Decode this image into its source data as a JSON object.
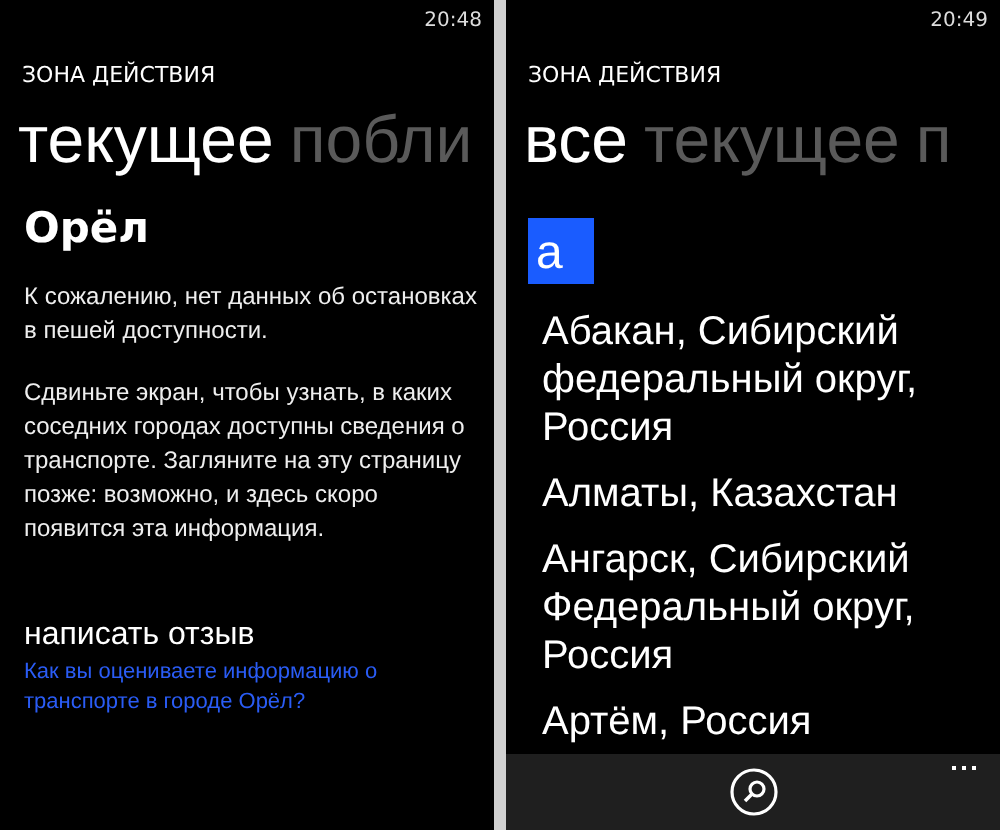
{
  "left_screen": {
    "time": "20:48",
    "app_title": "ЗОНА ДЕЙСТВИЯ",
    "pivot": [
      {
        "label": "текущее",
        "selected": true
      },
      {
        "label": "побли",
        "selected": false
      }
    ],
    "city": "Орёл",
    "paragraphs": [
      "К сожалению, нет данных об остановках в пешей доступности.",
      "Сдвиньте экран, чтобы узнать, в каких соседних городах доступны сведения о транспорте. Загляните на эту страницу позже: возможно, и здесь скоро появится эта информация."
    ],
    "feedback": {
      "title": "написать отзыв",
      "link": "Как вы оцениваете информацию о транспорте в городе Орёл?"
    }
  },
  "right_screen": {
    "time": "20:49",
    "app_title": "ЗОНА ДЕЙСТВИЯ",
    "pivot": [
      {
        "label": "все",
        "selected": true
      },
      {
        "label": "текущее",
        "selected": false
      },
      {
        "label": "п",
        "selected": false
      }
    ],
    "group_letter": "а",
    "cities": [
      "Абакан, Сибирский федеральный округ, Россия",
      "Алматы, Казахстан",
      "Ангарск, Сибирский Федеральный округ, Россия",
      "Артём, Россия"
    ]
  }
}
